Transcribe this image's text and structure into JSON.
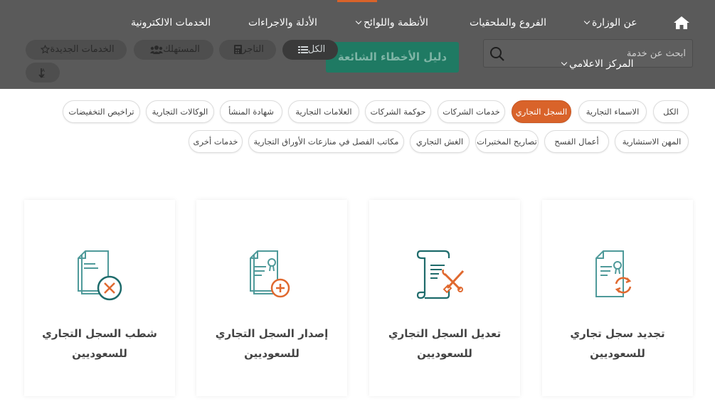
{
  "nav": {
    "home_icon": "home-icon",
    "items": [
      {
        "label": "عن الوزارة",
        "dropdown": true
      },
      {
        "label": "الفروع والملحقيات",
        "dropdown": false
      },
      {
        "label": "الأنظمة واللوائح",
        "dropdown": true
      },
      {
        "label": "الأدلة والاجراءات",
        "dropdown": false
      },
      {
        "label": "الخدمات الالكترونية",
        "dropdown": false
      }
    ],
    "media_center": "المركز الاعلامي"
  },
  "search": {
    "placeholder": "ابحث عن خدمة",
    "icon": "search-icon"
  },
  "mistakes_button": "دليل الأخطاء الشائعة",
  "audience": {
    "all": "الكل",
    "merchant": "التاجر",
    "consumer": "المستهلك",
    "new_services": "الخدمات الجديدة",
    "sort_icon": "sort-alpha-icon"
  },
  "filters": {
    "active": "السجل التجاري",
    "row1": [
      "الكل",
      "الاسماء التجارية",
      "السجل التجاري",
      "خدمات الشركات",
      "حوكمة الشركات",
      "العلامات التجارية",
      "شهادة المنشأ",
      "الوكالات التجارية",
      "تراخيص التخفيضات"
    ],
    "row2": [
      "المهن الاستشارية",
      "أعمال الفسح",
      "تصاريح المختبرات",
      "الغش التجاري",
      "مكاتب الفصل في منازعات الأوراق التجارية",
      "خدمات أخرى"
    ]
  },
  "cards": [
    {
      "title": "تجديد سجل تجاري للسعوديين",
      "icon": "document-renew-icon"
    },
    {
      "title": "تعديل السجل التجاري للسعوديين",
      "icon": "document-edit-tools-icon"
    },
    {
      "title": "إصدار السجل التجاري للسعوديين",
      "icon": "document-add-icon"
    },
    {
      "title": "شطب السجل التجاري للسعوديين",
      "icon": "document-delete-icon"
    }
  ],
  "colors": {
    "accent": "#d9632a",
    "teal": "#1f7a63",
    "header_bg": "#5a5a5a",
    "icon_teal": "#4f9a9a"
  }
}
